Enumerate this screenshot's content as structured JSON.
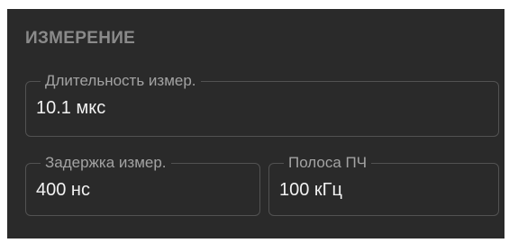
{
  "section": {
    "title": "ИЗМЕРЕНИЕ"
  },
  "fields": {
    "duration": {
      "label": "Длительность измер.",
      "value": "10.1 мкс"
    },
    "delay": {
      "label": "Задержка измер.",
      "value": "400 нс"
    },
    "if_bandwidth": {
      "label": "Полоса ПЧ",
      "value": "100 кГц"
    }
  },
  "colors": {
    "panel_bg": "#2a2a2a",
    "title": "#8a8a8a",
    "label": "#a3a3a3",
    "value": "#f2f2f2",
    "border": "#525252"
  }
}
